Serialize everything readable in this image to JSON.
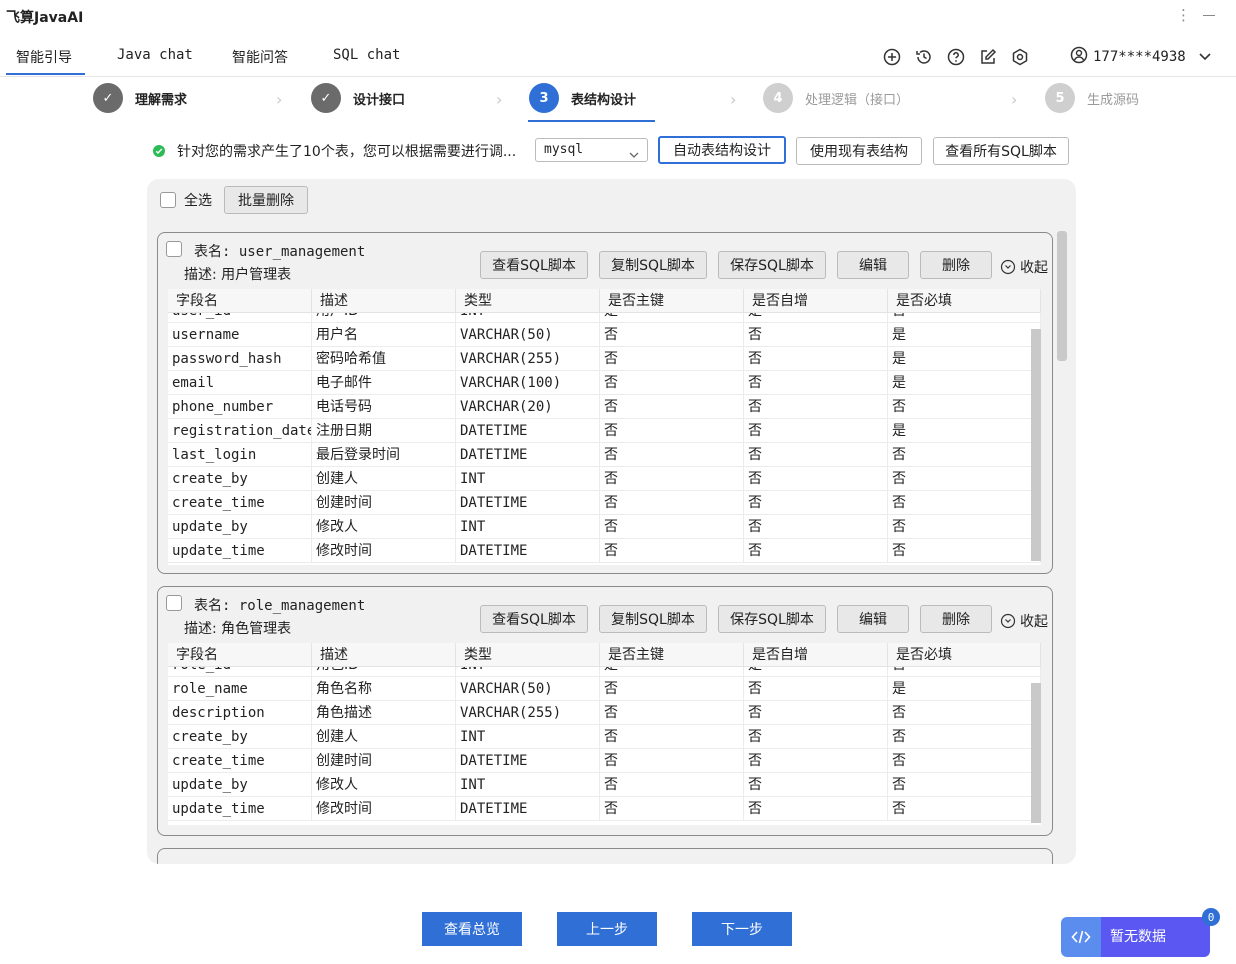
{
  "app": {
    "title": "飞算JavaAI"
  },
  "nav": {
    "tabs": [
      {
        "label": "智能引导",
        "active": true
      },
      {
        "label": "Java chat",
        "active": false
      },
      {
        "label": "智能问答",
        "active": false
      },
      {
        "label": "SQL chat",
        "active": false
      }
    ],
    "icons": [
      "add-icon",
      "history-icon",
      "help-icon",
      "edit-icon",
      "settings-icon"
    ],
    "user": {
      "phone": "177****4938"
    }
  },
  "stepper": {
    "steps": [
      {
        "index": "✓",
        "label": "理解需求",
        "state": "done"
      },
      {
        "index": "✓",
        "label": "设计接口",
        "state": "done"
      },
      {
        "index": "3",
        "label": "表结构设计",
        "state": "current"
      },
      {
        "index": "4",
        "label": "处理逻辑（接口）",
        "state": "todo"
      },
      {
        "index": "5",
        "label": "生成源码",
        "state": "todo"
      }
    ]
  },
  "toolbar": {
    "info": "针对您的需求产生了10个表，您可以根据需要进行调...",
    "db_select": "mysql",
    "btn_auto": "自动表结构设计",
    "btn_existing": "使用现有表结构",
    "btn_all_sql": "查看所有SQL脚本"
  },
  "panel": {
    "select_all": "全选",
    "batch_delete": "批量删除",
    "card_actions": {
      "view_sql": "查看SQL脚本",
      "copy_sql": "复制SQL脚本",
      "save_sql": "保存SQL脚本",
      "edit": "编辑",
      "delete": "删除",
      "collapse": "收起"
    },
    "columns": [
      "字段名",
      "描述",
      "类型",
      "是否主键",
      "是否自增",
      "是否必填"
    ],
    "tables": [
      {
        "name_label": "表名: user_management",
        "desc_label": "描述: 用户管理表",
        "partial_row": [
          "user_id",
          "用户ID",
          "INT",
          "是",
          "是",
          "否"
        ],
        "rows": [
          [
            "username",
            "用户名",
            "VARCHAR(50)",
            "否",
            "否",
            "是"
          ],
          [
            "password_hash",
            "密码哈希值",
            "VARCHAR(255)",
            "否",
            "否",
            "是"
          ],
          [
            "email",
            "电子邮件",
            "VARCHAR(100)",
            "否",
            "否",
            "是"
          ],
          [
            "phone_number",
            "电话号码",
            "VARCHAR(20)",
            "否",
            "否",
            "否"
          ],
          [
            "registration_date",
            "注册日期",
            "DATETIME",
            "否",
            "否",
            "是"
          ],
          [
            "last_login",
            "最后登录时间",
            "DATETIME",
            "否",
            "否",
            "否"
          ],
          [
            "create_by",
            "创建人",
            "INT",
            "否",
            "否",
            "否"
          ],
          [
            "create_time",
            "创建时间",
            "DATETIME",
            "否",
            "否",
            "否"
          ],
          [
            "update_by",
            "修改人",
            "INT",
            "否",
            "否",
            "否"
          ],
          [
            "update_time",
            "修改时间",
            "DATETIME",
            "否",
            "否",
            "否"
          ]
        ]
      },
      {
        "name_label": "表名: role_management",
        "desc_label": "描述: 角色管理表",
        "partial_row": [
          "role_id",
          "角色ID",
          "INT",
          "是",
          "是",
          "否"
        ],
        "rows": [
          [
            "role_name",
            "角色名称",
            "VARCHAR(50)",
            "否",
            "否",
            "是"
          ],
          [
            "description",
            "角色描述",
            "VARCHAR(255)",
            "否",
            "否",
            "否"
          ],
          [
            "create_by",
            "创建人",
            "INT",
            "否",
            "否",
            "否"
          ],
          [
            "create_time",
            "创建时间",
            "DATETIME",
            "否",
            "否",
            "否"
          ],
          [
            "update_by",
            "修改人",
            "INT",
            "否",
            "否",
            "否"
          ],
          [
            "update_time",
            "修改时间",
            "DATETIME",
            "否",
            "否",
            "否"
          ]
        ]
      }
    ]
  },
  "footer": {
    "overview": "查看总览",
    "prev": "上一步",
    "next": "下一步"
  },
  "widget": {
    "label": "暂无数据",
    "badge": "0"
  },
  "colors": {
    "accent": "#2f6fd6",
    "success": "#2dbb57",
    "widget": "#5a57f2"
  }
}
